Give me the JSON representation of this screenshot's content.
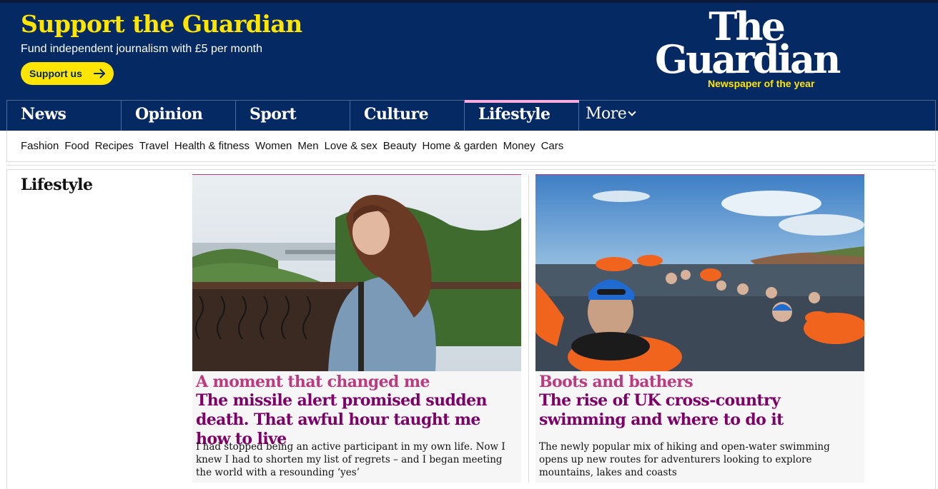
{
  "support": {
    "title": "Support the Guardian",
    "subtitle": "Fund independent journalism with £5 per month",
    "button_label": "Support us"
  },
  "logo": {
    "the": "The",
    "guardian": "Guardian",
    "tagline": "Newspaper of the year"
  },
  "pillars": [
    {
      "label": "News"
    },
    {
      "label": "Opinion"
    },
    {
      "label": "Sport"
    },
    {
      "label": "Culture"
    },
    {
      "label": "Lifestyle",
      "active": true
    },
    {
      "label": "More"
    }
  ],
  "subnav": [
    "Fashion",
    "Food",
    "Recipes",
    "Travel",
    "Health & fitness",
    "Women",
    "Men",
    "Love & sex",
    "Beauty",
    "Home & garden",
    "Money",
    "Cars"
  ],
  "section": {
    "title": "Lifestyle"
  },
  "cards": [
    {
      "kicker": "A moment that changed me",
      "headline": "The missile alert promised sudden death. That awful hour taught me how to live",
      "trail": "I had stopped being an active participant in my own life. Now I knew I had to shorten my list of regrets – and I began meeting the world with a resounding ‘yes’"
    },
    {
      "kicker": "Boots and bathers",
      "headline": "The rise of UK cross-country swimming and where to do it",
      "trail": "The newly popular mix of hiking and open-water swimming opens up new routes for adventurers looking to explore mountains, lakes and coasts"
    }
  ],
  "colors": {
    "brand_blue": "#052962",
    "support_yellow": "#ffe500",
    "lifestyle_kicker": "#bb3b80",
    "lifestyle_headline": "#7d0068",
    "lifestyle_accent": "#ffabdb"
  }
}
